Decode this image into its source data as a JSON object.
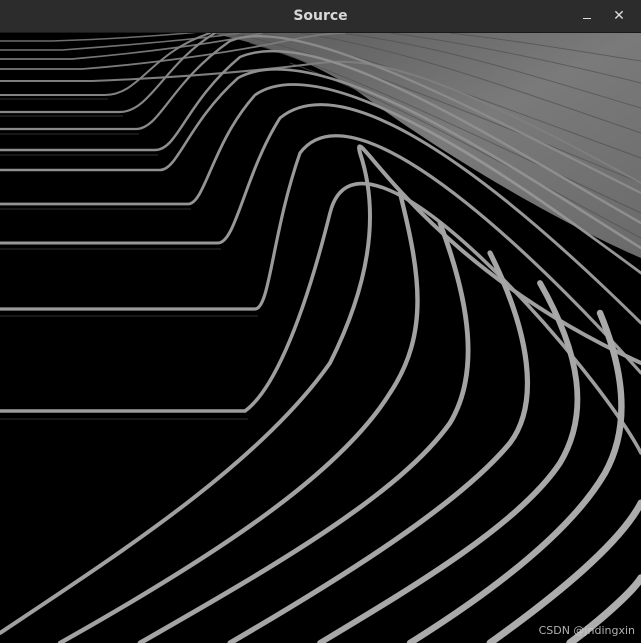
{
  "window": {
    "title": "Source",
    "minimize_glyph": "–",
    "close_glyph": "✕"
  },
  "image": {
    "watermark": "CSDN @jndingxin"
  },
  "colors": {
    "titlebar": "#2c2c2c",
    "title_text": "#d8d8d8",
    "background": "#000000",
    "stripe": "#8a8a8a",
    "wood": "#6e6e6e"
  }
}
